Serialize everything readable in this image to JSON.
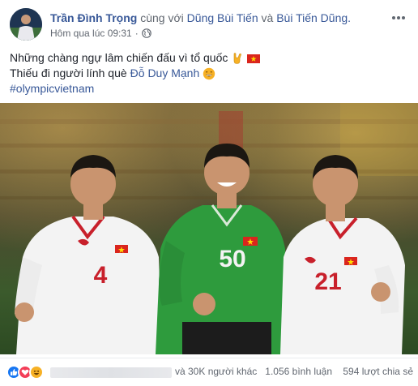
{
  "post": {
    "author": "Trần Đình Trọng",
    "with_text": "cùng với",
    "tagged_1": "Dũng Bùi Tiến",
    "and_text": "và",
    "tagged_2": "Bùi Tiến Dũng.",
    "timestamp": "Hôm qua lúc 09:31",
    "dot": "·",
    "privacy_icon": "globe-icon",
    "more_icon": "more-options-icon"
  },
  "content": {
    "line1": "Những chàng ngự lâm chiến đấu vì tổ quốc",
    "line2_prefix": "Thiếu đi người lính què",
    "line2_mention": "Đỗ Duy Mạnh",
    "hashtag": "#olympicvietnam",
    "emojis": [
      "rock-hand-icon",
      "vietnam-flag-icon",
      "grin-icon"
    ]
  },
  "photo": {
    "shirt_numbers": [
      "4",
      "50",
      "21"
    ]
  },
  "footer": {
    "reaction_icons": [
      "like-icon",
      "love-icon",
      "haha-icon"
    ],
    "others_text": "và 30K người khác",
    "comments": "1.056 bình luận",
    "shares": "594 lượt chia sẻ"
  },
  "colors": {
    "link": "#385898",
    "meta": "#616770",
    "text": "#1d2129",
    "like": "#1877f2",
    "love": "#f33e58",
    "haha": "#f7b125",
    "jersey_white": "#f4f4f4",
    "jersey_green": "#2e9b3d",
    "jersey_red": "#c8202b"
  }
}
